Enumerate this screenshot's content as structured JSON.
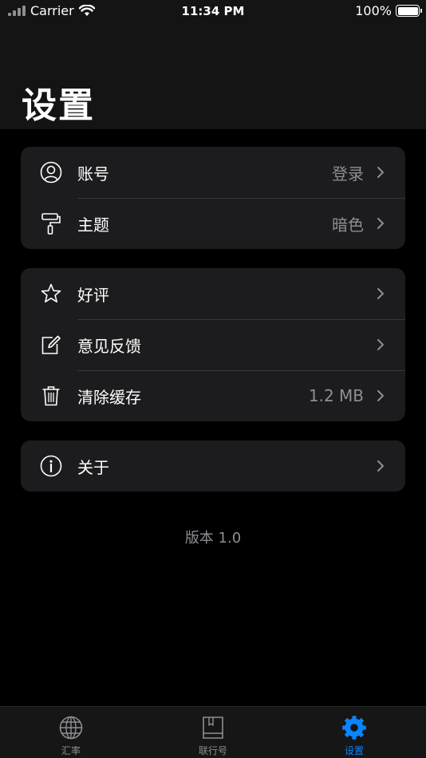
{
  "status_bar": {
    "carrier": "Carrier",
    "time": "11:34 PM",
    "battery_percent": "100%",
    "battery_level": 1.0
  },
  "header": {
    "title": "设置"
  },
  "groups": [
    {
      "rows": [
        {
          "icon": "person-circle-icon",
          "label": "账号",
          "value": "登录"
        },
        {
          "icon": "paint-roller-icon",
          "label": "主题",
          "value": "暗色"
        }
      ]
    },
    {
      "rows": [
        {
          "icon": "star-icon",
          "label": "好评",
          "value": ""
        },
        {
          "icon": "edit-note-icon",
          "label": "意见反馈",
          "value": ""
        },
        {
          "icon": "trash-icon",
          "label": "清除缓存",
          "value": "1.2 MB"
        }
      ]
    },
    {
      "rows": [
        {
          "icon": "info-circle-icon",
          "label": "关于",
          "value": ""
        }
      ]
    }
  ],
  "version_text": "版本 1.0",
  "tabbar": {
    "tabs": [
      {
        "icon": "globe-icon",
        "label": "汇率",
        "active": false
      },
      {
        "icon": "book-icon",
        "label": "联行号",
        "active": false
      },
      {
        "icon": "gear-icon",
        "label": "设置",
        "active": true
      }
    ]
  },
  "colors": {
    "accent": "#0a84ff",
    "cell_bg": "#1c1c1e",
    "secondary_text": "#8e8e93"
  }
}
